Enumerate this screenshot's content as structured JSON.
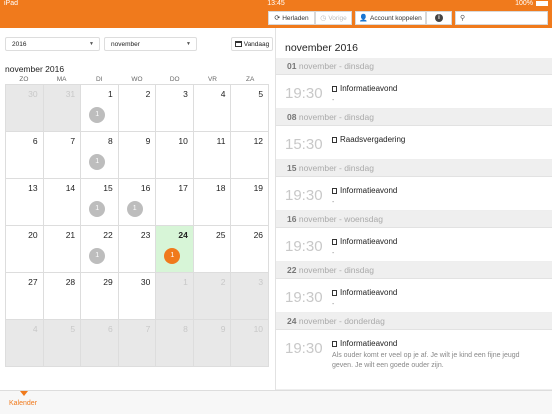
{
  "status": {
    "device": "iPad",
    "time": "13:45",
    "battery": "100%"
  },
  "toolbar": {
    "reload_label": "Herladen",
    "prev_label": "Vorige",
    "account_label": "Account koppelen",
    "info_icon": "i",
    "search_placeholder": ""
  },
  "filters": {
    "year": "2016",
    "month": "november",
    "today_label": "Vandaag"
  },
  "calendar": {
    "title": "november 2016",
    "weekdays": [
      "ZO",
      "MA",
      "DI",
      "WO",
      "DO",
      "VR",
      "ZA"
    ],
    "weeks": [
      [
        {
          "n": "30",
          "o": true
        },
        {
          "n": "31",
          "o": true
        },
        {
          "n": "1",
          "b": "1"
        },
        {
          "n": "2"
        },
        {
          "n": "3"
        },
        {
          "n": "4"
        },
        {
          "n": "5"
        }
      ],
      [
        {
          "n": "6"
        },
        {
          "n": "7"
        },
        {
          "n": "8",
          "b": "1"
        },
        {
          "n": "9"
        },
        {
          "n": "10"
        },
        {
          "n": "11"
        },
        {
          "n": "12"
        }
      ],
      [
        {
          "n": "13"
        },
        {
          "n": "14"
        },
        {
          "n": "15",
          "b": "1"
        },
        {
          "n": "16",
          "b": "1"
        },
        {
          "n": "17"
        },
        {
          "n": "18"
        },
        {
          "n": "19"
        }
      ],
      [
        {
          "n": "20"
        },
        {
          "n": "21"
        },
        {
          "n": "22",
          "b": "1"
        },
        {
          "n": "23"
        },
        {
          "n": "24",
          "b": "1",
          "sel": true
        },
        {
          "n": "25"
        },
        {
          "n": "26"
        }
      ],
      [
        {
          "n": "27"
        },
        {
          "n": "28"
        },
        {
          "n": "29"
        },
        {
          "n": "30"
        },
        {
          "n": "1",
          "o": true
        },
        {
          "n": "2",
          "o": true
        },
        {
          "n": "3",
          "o": true
        }
      ],
      [
        {
          "n": "4",
          "o": true
        },
        {
          "n": "5",
          "o": true
        },
        {
          "n": "6",
          "o": true
        },
        {
          "n": "7",
          "o": true
        },
        {
          "n": "8",
          "o": true
        },
        {
          "n": "9",
          "o": true
        },
        {
          "n": "10",
          "o": true
        }
      ]
    ]
  },
  "agenda": {
    "title": "november 2016",
    "days": [
      {
        "num": "01",
        "label": "november - dinsdag",
        "events": [
          {
            "time": "19:30",
            "title": "Informatieavond",
            "desc": "-"
          }
        ]
      },
      {
        "num": "08",
        "label": "november - dinsdag",
        "events": [
          {
            "time": "15:30",
            "title": "Raadsvergadering",
            "desc": ""
          }
        ]
      },
      {
        "num": "15",
        "label": "november - dinsdag",
        "events": [
          {
            "time": "19:30",
            "title": "Informatieavond",
            "desc": "-"
          }
        ]
      },
      {
        "num": "16",
        "label": "november - woensdag",
        "events": [
          {
            "time": "19:30",
            "title": "Informatieavond",
            "desc": "-"
          }
        ]
      },
      {
        "num": "22",
        "label": "november - dinsdag",
        "events": [
          {
            "time": "19:30",
            "title": "Informatieavond",
            "desc": "-"
          }
        ]
      },
      {
        "num": "24",
        "label": "november - donderdag",
        "events": [
          {
            "time": "19:30",
            "title": "Informatieavond",
            "desc": "Als ouder komt er veel op je af. Je wilt je kind een fijne jeugd geven. Je wilt een goede ouder zijn."
          }
        ]
      }
    ]
  },
  "tabbar": {
    "calendar_label": "Kalender"
  },
  "colors": {
    "accent": "#f07a1c",
    "selected_day": "#d7f5d7"
  }
}
